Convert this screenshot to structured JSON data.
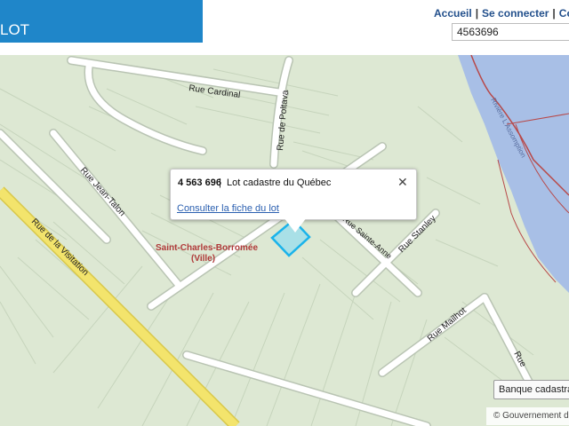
{
  "header": {
    "title": "LOT",
    "nav": {
      "home": "Accueil",
      "login": "Se connecter",
      "comm": "Comm"
    },
    "search_value": "4563696"
  },
  "map": {
    "streets": {
      "rue_cardinal": "Rue Cardinal",
      "rue_de_poltava": "Rue de Poltava",
      "rue_jean_talon": "Rue Jean-Talon",
      "rue_de_la_visitation": "Rue de la Visitation",
      "rue_sainte_anne": "Rue Sainte-Anne",
      "rue_stanley": "Rue Stanley",
      "rue_mailhot": "Rue Mailhot",
      "rue_fragment": "Rue"
    },
    "place_label": {
      "line1": "Saint-Charles-Borromée",
      "line2": "(Ville)"
    },
    "river_label": "Rivière L'Assomption",
    "popup": {
      "lot_number": "4 563 696",
      "separator": "|",
      "description": "Lot cadastre du Québec",
      "link": "Consulter la fiche du lot",
      "close": "✕"
    },
    "legend_button": "Banque cadastra",
    "attribution": "© Gouvernement du",
    "colors": {
      "water": "#a8bfe6",
      "land": "#dde8d3",
      "road": "#ffffff",
      "highway": "#f3e46c",
      "lot_highlight": "#6ad6ff",
      "header_blue": "#1f86c9"
    }
  }
}
